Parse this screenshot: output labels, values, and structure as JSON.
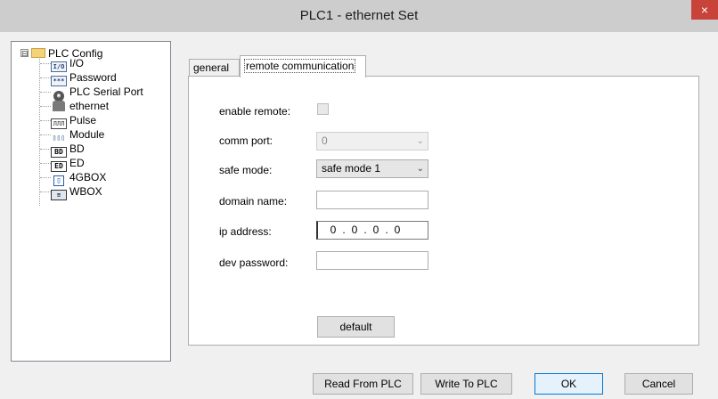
{
  "window": {
    "title": "PLC1 - ethernet  Set",
    "close_label": "×"
  },
  "tree": {
    "root": {
      "expander": "⊟",
      "label": "PLC Config"
    },
    "items": [
      {
        "icon_text": "I/O",
        "label": "I/O"
      },
      {
        "icon_text": "***",
        "label": "Password"
      },
      {
        "icon_text": "◉",
        "label": "PLC Serial Port"
      },
      {
        "icon_text": "",
        "label": "ethernet"
      },
      {
        "icon_text": "ЛЛЛ",
        "label": "Pulse"
      },
      {
        "icon_text": "▯▯▯",
        "label": "Module"
      },
      {
        "icon_text": "BD",
        "label": "BD"
      },
      {
        "icon_text": "ED",
        "label": "ED"
      },
      {
        "icon_text": "▯",
        "label": "4GBOX"
      },
      {
        "icon_text": "≡",
        "label": "WBOX"
      }
    ]
  },
  "tabs": {
    "general": "general",
    "remote": "remote communication"
  },
  "form": {
    "enable_remote_label": "enable remote:",
    "comm_port_label": "comm port:",
    "comm_port_value": "0",
    "safe_mode_label": "safe mode:",
    "safe_mode_value": "safe mode 1",
    "domain_name_label": "domain name:",
    "domain_name_value": "",
    "ip_address_label": "ip address:",
    "ip_octets": [
      "0",
      "0",
      "0",
      "0"
    ],
    "dev_password_label": "dev password:",
    "dev_password_value": "",
    "default_button": "default"
  },
  "buttons": {
    "read": "Read From PLC",
    "write": "Write To PLC",
    "ok": "OK",
    "cancel": "Cancel"
  }
}
